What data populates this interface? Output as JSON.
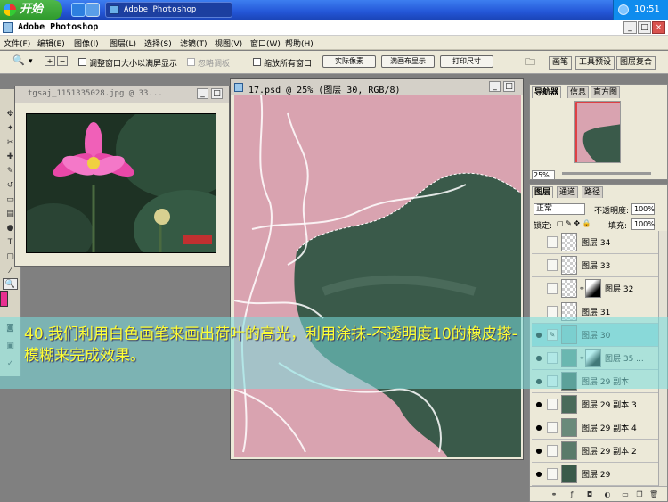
{
  "taskbar": {
    "start_label": "开始",
    "task_label": "Adobe Photoshop",
    "clock": "10:51"
  },
  "window": {
    "title": "Adobe Photoshop",
    "min": "_",
    "max": "□",
    "close": "×"
  },
  "menu": [
    "文件(F)",
    "编辑(E)",
    "图像(I)",
    "图层(L)",
    "选择(S)",
    "滤镜(T)",
    "视图(V)",
    "窗口(W)",
    "帮助(H)"
  ],
  "options": {
    "resize_windows": "调整窗口大小以满屏显示",
    "ignore_palettes": "忽略调板",
    "zoom_all": "缩放所有窗口",
    "actual_pixels": "实际像素",
    "fit_screen": "满画布显示",
    "print_size": "打印尺寸"
  },
  "palette_tabs": [
    "画笔",
    "工具预设",
    "图层复合"
  ],
  "doc1": {
    "title": "tgsaj_1151335028.jpg @ 33..."
  },
  "doc2": {
    "title": "17.psd @ 25% (图层 30, RGB/8)"
  },
  "navigator": {
    "tabs": [
      "导航器",
      "信息",
      "直方图"
    ],
    "zoom": "25%"
  },
  "layers": {
    "tabs": [
      "图层",
      "通道",
      "路径"
    ],
    "blend_mode": "正常",
    "opacity_label": "不透明度:",
    "opacity_value": "100%",
    "lock_label": "锁定:",
    "fill_label": "填充:",
    "fill_value": "100%",
    "items": [
      {
        "name": "图层 34",
        "visible": false,
        "mask": false,
        "selected": false
      },
      {
        "name": "图层 33",
        "visible": false,
        "mask": false,
        "selected": false
      },
      {
        "name": "图层 32",
        "visible": false,
        "mask": true,
        "selected": false
      },
      {
        "name": "图层 31",
        "visible": false,
        "mask": false,
        "selected": false
      },
      {
        "name": "图层 30",
        "visible": true,
        "mask": false,
        "selected": true
      },
      {
        "name": "图层 35 ...",
        "visible": true,
        "mask": true,
        "selected": false
      },
      {
        "name": "图层 29 副本",
        "visible": true,
        "mask": false,
        "selected": false
      },
      {
        "name": "图层 29 副本 3",
        "visible": true,
        "mask": false,
        "selected": false
      },
      {
        "name": "图层 29 副本 4",
        "visible": true,
        "mask": false,
        "selected": false
      },
      {
        "name": "图层 29 副本 2",
        "visible": true,
        "mask": false,
        "selected": false
      },
      {
        "name": "图层 29",
        "visible": true,
        "mask": false,
        "selected": false
      }
    ]
  },
  "caption": "40.我们利用白色画笔来画出荷叶的高光，利用涂抹-不透明度10的橡皮搽-模糊来完成效果。",
  "colors": {
    "foreground": "#e83090",
    "canvas_bg": "#d9a3b0",
    "leaf": "#3a5a4a",
    "caption_text": "#ffff33"
  }
}
